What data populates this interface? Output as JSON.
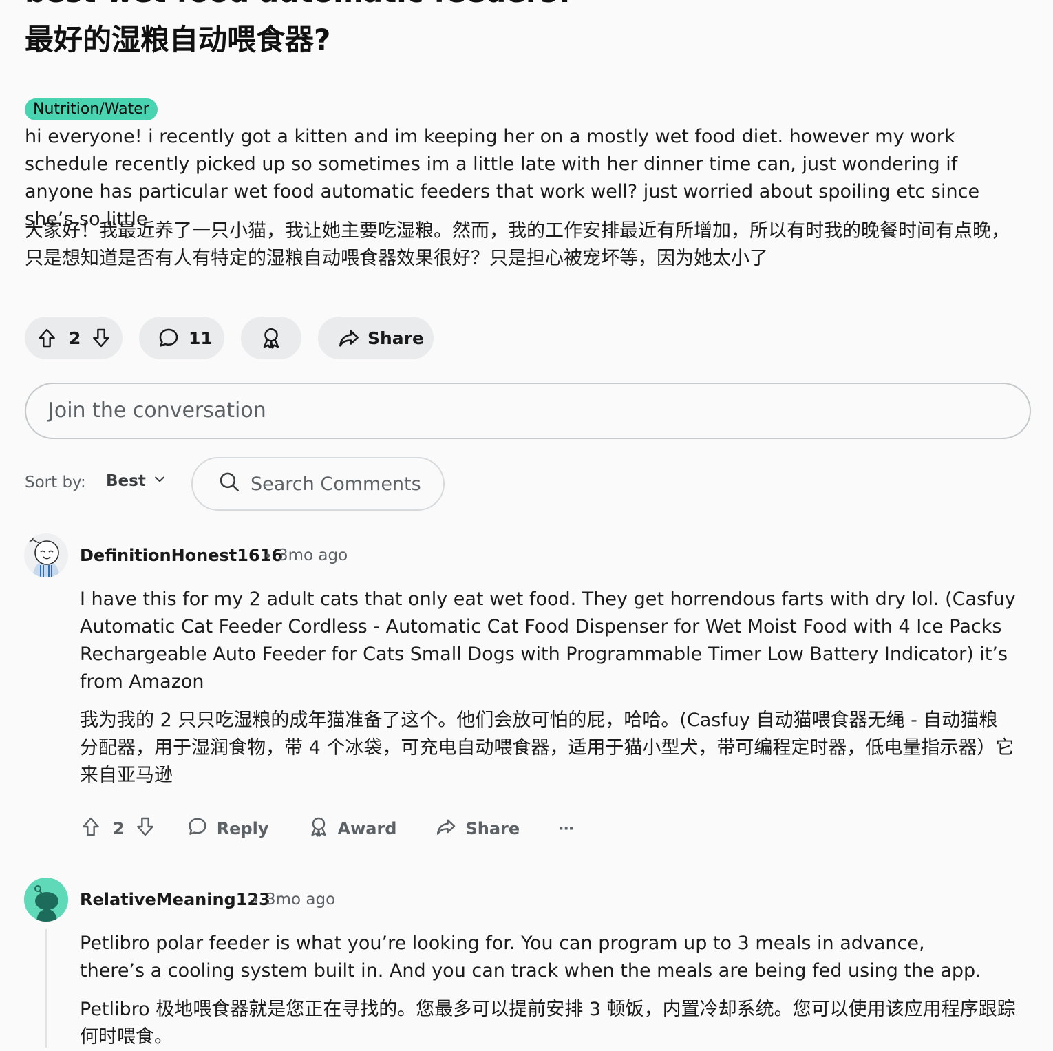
{
  "post": {
    "title_en": "best wet food automatic feeders?",
    "title_cn": "最好的湿粮自动喂食器?",
    "flair": "Nutrition/Water",
    "body_en": "hi everyone! i recently got a kitten and im keeping her on a mostly wet food diet. however my work schedule recently picked up so sometimes im a little late with her dinner time can, just wondering if anyone has particular wet food automatic feeders that work well? just worried about spoiling etc since she’s so little",
    "body_cn": "大家好！我最近养了一只小猫，我让她主要吃湿粮。然而，我的工作安排最近有所增加，所以有时我的晚餐时间有点晚，只是想知道是否有人有特定的湿粮自动喂食器效果很好？只是担心被宠坏等，因为她太小了",
    "vote_count": "2",
    "comment_count": "11",
    "share_label": "Share"
  },
  "composer": {
    "placeholder": "Join the conversation"
  },
  "sort": {
    "label": "Sort by:",
    "value": "Best"
  },
  "search": {
    "placeholder": "Search Comments"
  },
  "comments": [
    {
      "username": "DefinitionHonest1616",
      "separator": "•",
      "time": "3mo ago",
      "body_en": "I have this for my 2 adult cats that only eat wet food. They get horrendous farts with dry lol. (Casfuy Automatic Cat Feeder Cordless - Automatic Cat Food Dispenser for Wet Moist Food with 4 Ice Packs Rechargeable Auto Feeder for Cats Small Dogs with Programmable Timer Low Battery Indicator) it’s from Amazon",
      "body_cn": "我为我的 2 只只吃湿粮的成年猫准备了这个。他们会放可怕的屁，哈哈。(Casfuy 自动猫喂食器无绳 - 自动猫粮分配器，用于湿润食物，带 4 个冰袋，可充电自动喂食器，适用于猫小型犬，带可编程定时器，低电量指示器）它来自亚马逊",
      "votes": "2",
      "reply_label": "Reply",
      "award_label": "Award",
      "share_label": "Share",
      "more_label": "···"
    },
    {
      "username": "RelativeMeaning123",
      "separator": "•",
      "time": "3mo ago",
      "body_en": "Petlibro polar feeder is what you’re looking for. You can program up to 3 meals in advance, there’s a cooling system built in. And you can track when the meals are being fed using the app.",
      "body_cn": "Petlibro 极地喂食器就是您正在寻找的。您最多可以提前安排 3 顿饭，内置冷却系统。您可以使用该应用程序跟踪何时喂食。"
    }
  ],
  "colors": {
    "flair_bg": "#48d4b0",
    "pill_bg": "#e9ebed",
    "avatar2_bg": "#5fd9b8",
    "muted_text": "#5c6166"
  }
}
